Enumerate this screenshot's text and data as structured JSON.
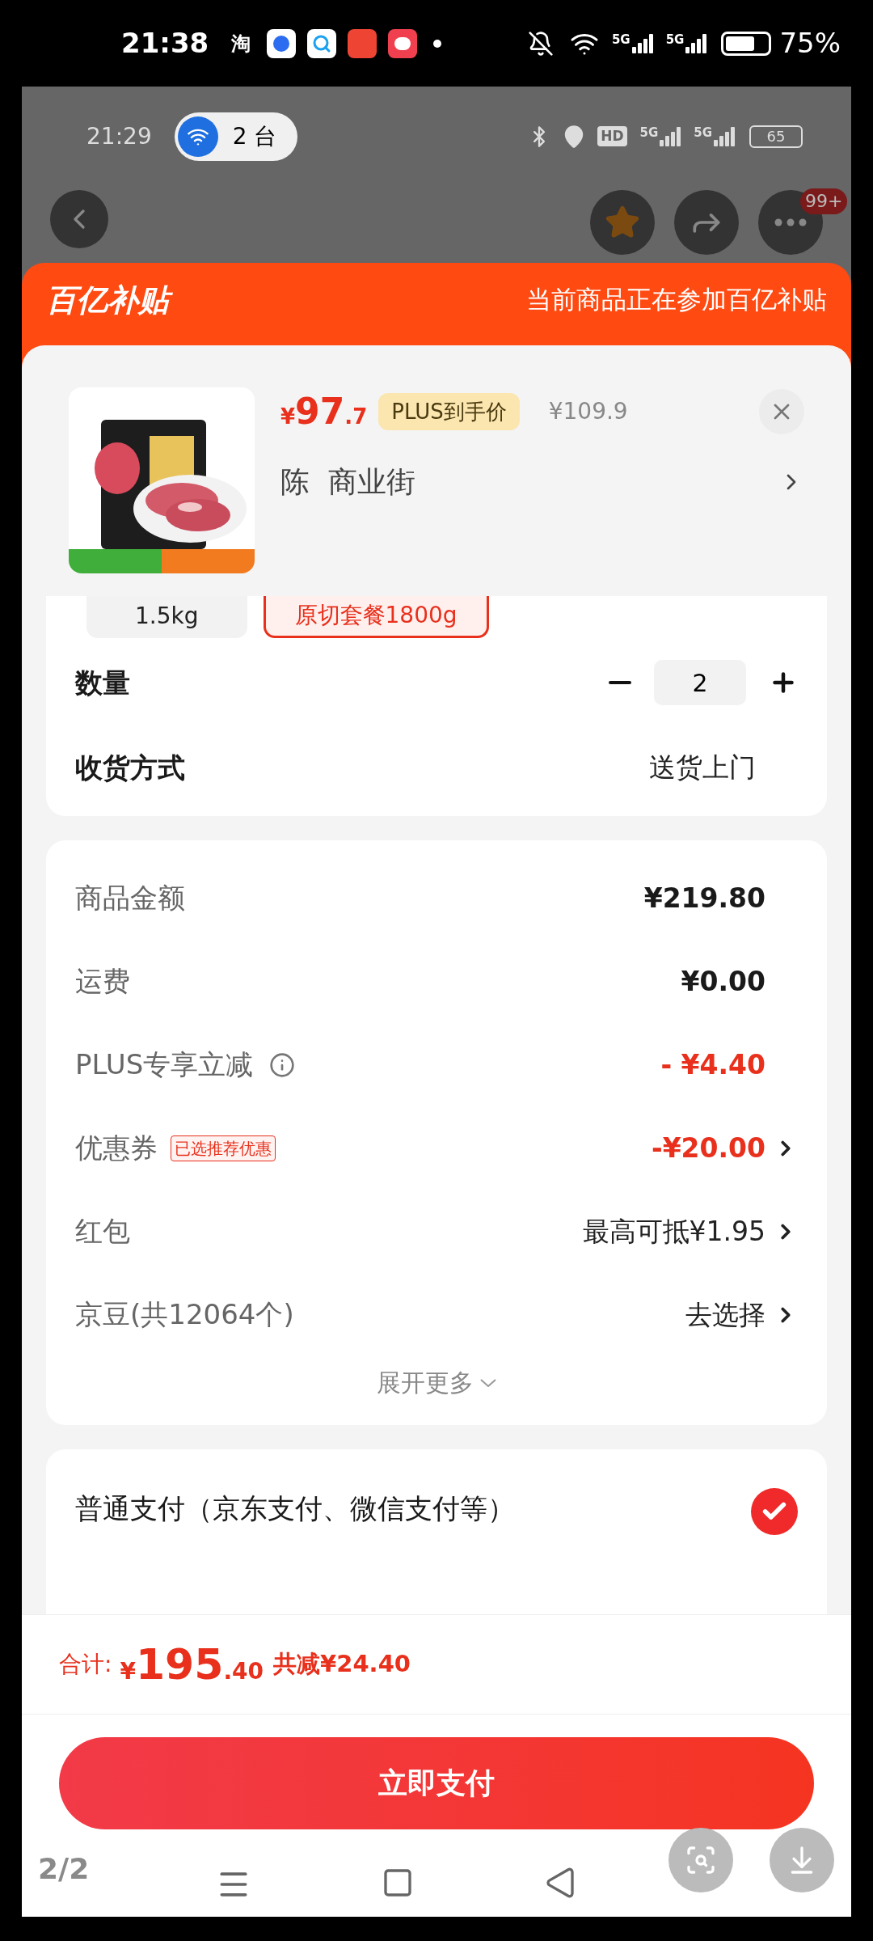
{
  "system_status": {
    "time": "21:38",
    "app_glyph": "淘",
    "signal_labels": [
      "5G",
      "5G"
    ],
    "battery": "75%"
  },
  "inner_status": {
    "time": "21:29",
    "hotspot": "2 台",
    "hd": "HD",
    "signal_labels": [
      "5G",
      "5G"
    ],
    "battery": "65"
  },
  "nav": {
    "badge": "99+"
  },
  "banner": {
    "logo": "百亿补贴",
    "text": "当前商品正在参加百亿补贴"
  },
  "product": {
    "currency": "¥",
    "price_int": "97",
    "price_dec": ".7",
    "price_tag": "PLUS到手价",
    "original_price": "¥109.9",
    "address": "陈  商业街"
  },
  "specs": [
    {
      "label": "1.5kg",
      "selected": false
    },
    {
      "label": "原切套餐1800g",
      "selected": true
    }
  ],
  "quantity": {
    "label": "数量",
    "value": "2"
  },
  "delivery": {
    "label": "收货方式",
    "value": "送货上门"
  },
  "fees": [
    {
      "label": "商品金额",
      "value": "¥219.80",
      "kind": "amount"
    },
    {
      "label": "运费",
      "value": "¥0.00",
      "kind": "amount"
    },
    {
      "label": "PLUS专享立减",
      "value": "- ¥4.40",
      "kind": "discount",
      "info": true
    },
    {
      "label": "优惠券",
      "tag": "已选推荐优惠",
      "value": "-¥20.00",
      "kind": "discount",
      "link": true
    },
    {
      "label": "红包",
      "value": "最高可抵¥1.95",
      "kind": "option",
      "link": true
    },
    {
      "label": "京豆(共12064个)",
      "value": "去选择",
      "kind": "option",
      "link": true
    }
  ],
  "expand": "展开更多",
  "payment": {
    "label": "普通支付（京东支付、微信支付等）",
    "checked": true
  },
  "total": {
    "label": "合计:",
    "currency": "¥",
    "int": "195",
    "dec": ".40",
    "saved": "共减¥24.40"
  },
  "pay_button": "立即支付",
  "page_indicator": "2/2"
}
